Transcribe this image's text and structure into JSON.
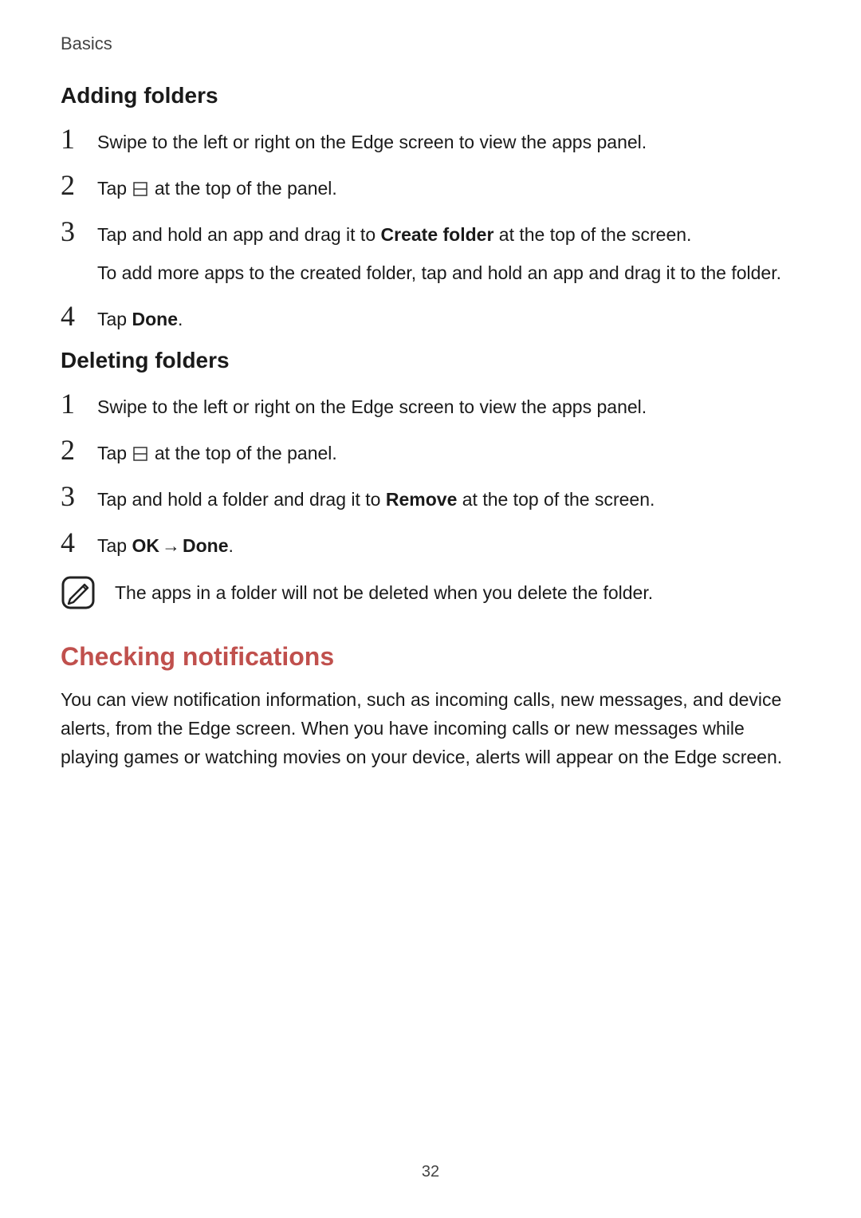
{
  "headerLabel": "Basics",
  "sections": {
    "adding": {
      "title": "Adding folders",
      "steps": {
        "s1_num": "1",
        "s1_text": "Swipe to the left or right on the Edge screen to view the apps panel.",
        "s2_num": "2",
        "s2_pre": "Tap ",
        "s2_post": " at the top of the panel.",
        "s3_num": "3",
        "s3_pre": "Tap and hold an app and drag it to ",
        "s3_bold": "Create folder",
        "s3_post": " at the top of the screen.",
        "s3_extra": "To add more apps to the created folder, tap and hold an app and drag it to the folder.",
        "s4_num": "4",
        "s4_pre": "Tap ",
        "s4_bold": "Done",
        "s4_post": "."
      }
    },
    "deleting": {
      "title": "Deleting folders",
      "steps": {
        "s1_num": "1",
        "s1_text": "Swipe to the left or right on the Edge screen to view the apps panel.",
        "s2_num": "2",
        "s2_pre": "Tap ",
        "s2_post": " at the top of the panel.",
        "s3_num": "3",
        "s3_pre": "Tap and hold a folder and drag it to ",
        "s3_bold": "Remove",
        "s3_post": " at the top of the screen.",
        "s4_num": "4",
        "s4_pre": "Tap ",
        "s4_bold1": "OK",
        "s4_arrow": "→",
        "s4_bold2": "Done",
        "s4_post": "."
      },
      "note": "The apps in a folder will not be deleted when you delete the folder."
    },
    "notifications": {
      "title": "Checking notifications",
      "para": "You can view notification information, such as incoming calls, new messages, and device alerts, from the Edge screen. When you have incoming calls or new messages while playing games or watching movies on your device, alerts will appear on the Edge screen."
    }
  },
  "pageNumber": "32"
}
